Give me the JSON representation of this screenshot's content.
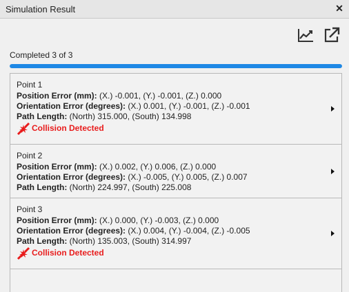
{
  "window": {
    "title": "Simulation Result",
    "close_glyph": "✕"
  },
  "toolbar": {
    "chart_icon": "line-chart-icon",
    "export_icon": "external-link-icon"
  },
  "status": {
    "text": "Completed 3 of 3",
    "progress": 1.0,
    "progress_color": "#1e88e5"
  },
  "labels": {
    "position": "Position Error (mm):",
    "orientation": "Orientation Error (degrees):",
    "path": "Path Length:",
    "collision": "Collision Detected",
    "collision_color": "#e81c1c"
  },
  "points": [
    {
      "name": "Point 1",
      "position": " (X.) -0.001, (Y.) -0.001, (Z.) 0.000",
      "orientation": " (X.) 0.001, (Y.) -0.001, (Z.) -0.001",
      "path": " (North) 315.000, (South) 134.998",
      "collision": true
    },
    {
      "name": "Point 2",
      "position": " (X.) 0.002, (Y.) 0.006, (Z.) 0.000",
      "orientation": " (X.) -0.005, (Y.) 0.005, (Z.) 0.007",
      "path": " (North) 224.997, (South) 225.008",
      "collision": false
    },
    {
      "name": "Point 3",
      "position": " (X.) 0.000, (Y.) -0.003, (Z.) 0.000",
      "orientation": " (X.) 0.004, (Y.) -0.004, (Z.) -0.005",
      "path": " (North) 135.003, (South) 314.997",
      "collision": true
    }
  ]
}
